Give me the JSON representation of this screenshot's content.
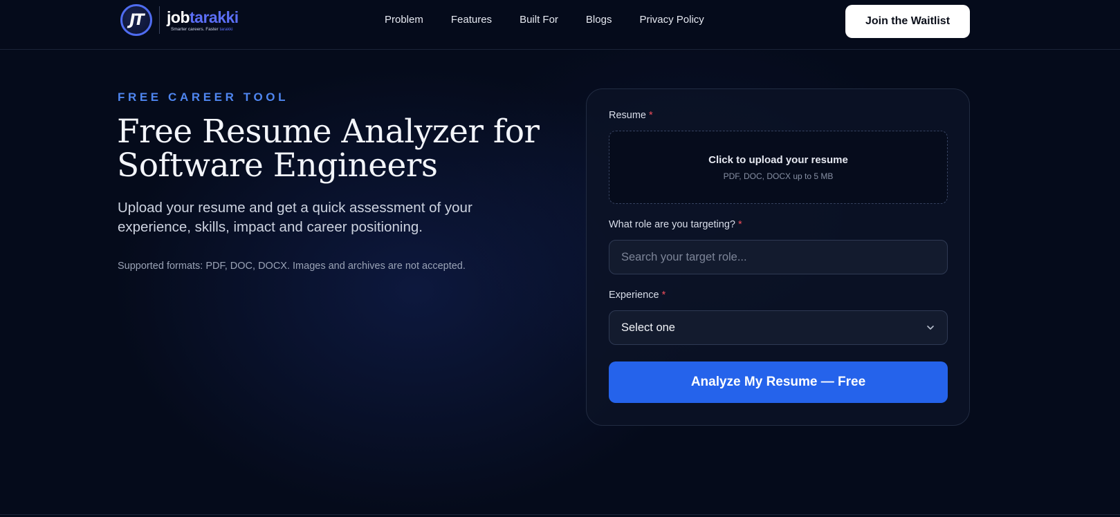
{
  "brand": {
    "mark": "JT",
    "word_a": "job",
    "word_b": "tarakki",
    "tagline_a": "Smarter careers. Faster ",
    "tagline_b": "tarakki"
  },
  "nav": {
    "items": [
      "Problem",
      "Features",
      "Built For",
      "Blogs",
      "Privacy Policy"
    ],
    "cta": "Join the Waitlist"
  },
  "hero": {
    "eyebrow": "FREE CAREER TOOL",
    "title": "Free Resume Analyzer for Software Engineers",
    "subtitle": "Upload your resume and get a quick assessment of your experience, skills, impact and career positioning.",
    "note": "Supported formats: PDF, DOC, DOCX. Images and archives are not accepted."
  },
  "form": {
    "resume_label": "Resume",
    "required_mark": "*",
    "upload_title": "Click to upload your resume",
    "upload_hint": "PDF, DOC, DOCX up to 5 MB",
    "role_label": "What role are you targeting?",
    "role_placeholder": "Search your target role...",
    "role_value": "",
    "experience_label": "Experience",
    "experience_value": "Select one",
    "submit_label": "Analyze My Resume — Free"
  },
  "colors": {
    "background": "#050b1b",
    "accent": "#2563eb",
    "eyebrow": "#4f86f0",
    "required": "#f04d5a",
    "brand": "#5b6ef5"
  }
}
